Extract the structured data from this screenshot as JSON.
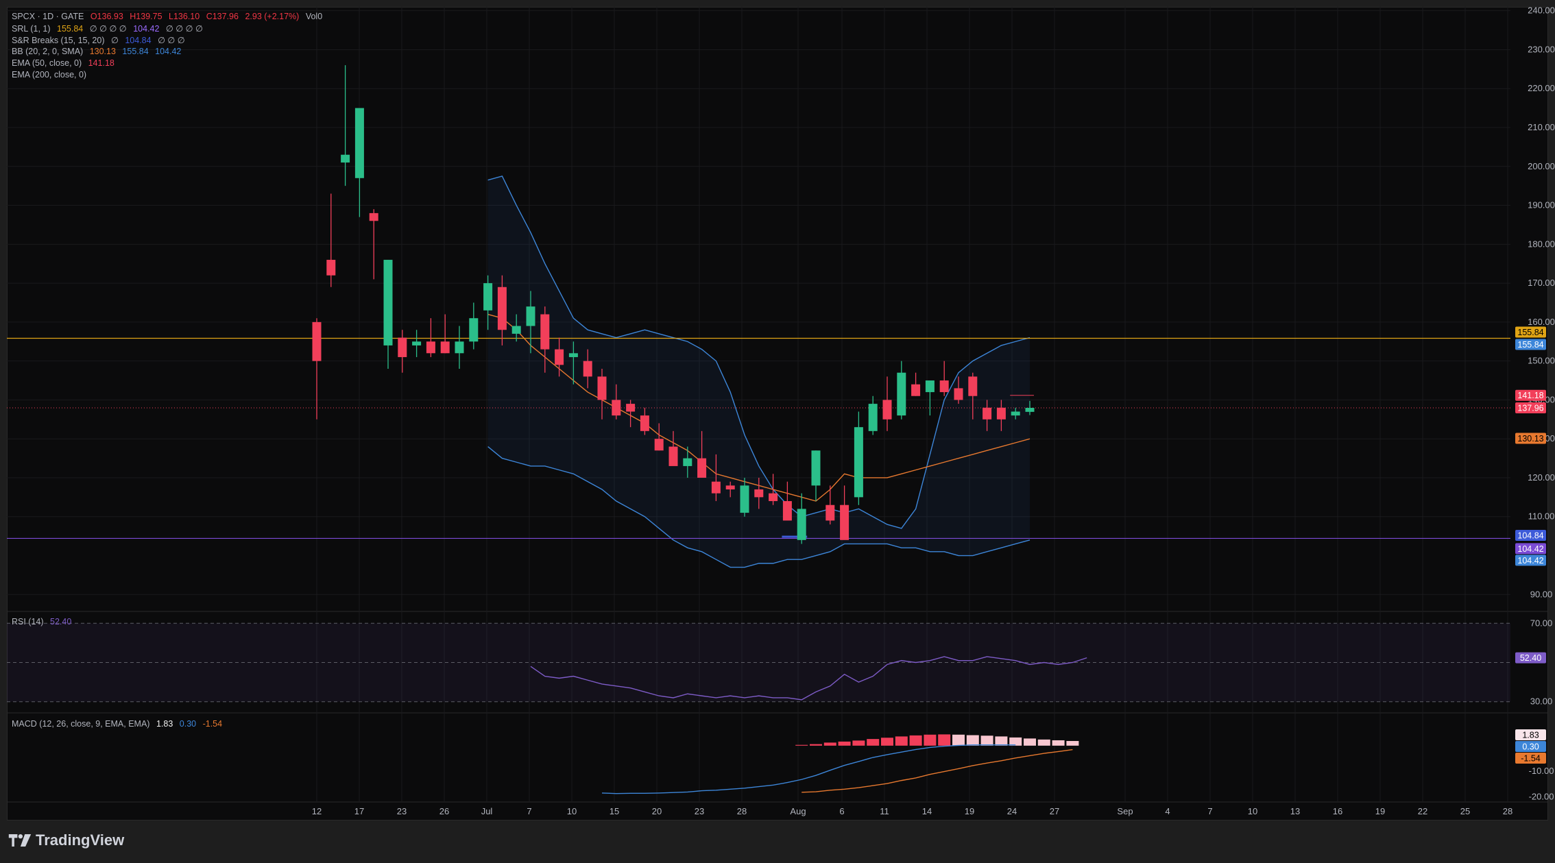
{
  "brand": "TradingView",
  "legend": {
    "symbol": "SPCX · 1D · GATE",
    "ohlc": {
      "o": "O136.93",
      "h": "H139.75",
      "l": "L136.10",
      "c": "C137.96",
      "chg": "2.93 (+2.17%)",
      "vol": "Vol0"
    },
    "srl": {
      "label": "SRL (1, 1)",
      "v1": "155.84",
      "nulls": "∅ ∅ ∅ ∅",
      "v2": "104.42",
      "nulls2": "∅ ∅ ∅ ∅"
    },
    "srb": {
      "label": "S&R Breaks (15, 15, 20)",
      "n1": "∅",
      "v1": "104.84",
      "nulls": "∅ ∅ ∅"
    },
    "bb": {
      "label": "BB (20, 2, 0, SMA)",
      "basis": "130.13",
      "upper": "155.84",
      "lower": "104.42"
    },
    "ema50": {
      "label": "EMA (50, close, 0)",
      "value": "141.18"
    },
    "ema200": {
      "label": "EMA (200, close, 0)"
    },
    "rsi": {
      "label": "RSI (14)",
      "value": "52.40"
    },
    "macd": {
      "label": "MACD (12, 26, close, 9, EMA, EMA)",
      "hist": "1.83",
      "macd": "0.30",
      "signal": "-1.54"
    }
  },
  "colors": {
    "up": "#2bbf8a",
    "down": "#f23f5a",
    "bb": "#3d86d9",
    "basis": "#e8792f",
    "srl_res": "#e0a415",
    "srl_sup": "#7b4bd6",
    "rsi": "#7e5cc8",
    "macd": "#3d86d9",
    "signal": "#e8792f"
  },
  "chart_data": [
    {
      "type": "candlestick",
      "title": "SPCX · 1D · GATE",
      "ylim": [
        86,
        241
      ],
      "yticks": [
        "90.00",
        "110.00",
        "120.00",
        "130.00",
        "140.00",
        "150.00",
        "160.00",
        "170.00",
        "180.00",
        "190.00",
        "200.00",
        "210.00",
        "220.00",
        "230.00",
        "240.00"
      ],
      "xticks": [
        "12",
        "17",
        "23",
        "26",
        "Jul",
        "7",
        "10",
        "15",
        "20",
        "23",
        "28",
        "Aug",
        "6",
        "11",
        "14",
        "19",
        "24",
        "27",
        "Sep",
        "4",
        "7",
        "10",
        "13",
        "16",
        "19",
        "22",
        "25",
        "28"
      ],
      "candles": [
        [
          160,
          161,
          135,
          150
        ],
        [
          176,
          193,
          169,
          172
        ],
        [
          201,
          226,
          195,
          203
        ],
        [
          197,
          214,
          187,
          215
        ],
        [
          188,
          189,
          171,
          186
        ],
        [
          154,
          176,
          148,
          176
        ],
        [
          156,
          158,
          147,
          151
        ],
        [
          154,
          158,
          151,
          155
        ],
        [
          155,
          161,
          151,
          152
        ],
        [
          155,
          162,
          152,
          152
        ],
        [
          152,
          159,
          148,
          155
        ],
        [
          155,
          165,
          153,
          161
        ],
        [
          163,
          172,
          158,
          170
        ],
        [
          169,
          172,
          154,
          158
        ],
        [
          157,
          162,
          155,
          159
        ],
        [
          159,
          168,
          152,
          164
        ],
        [
          162,
          164,
          147,
          153
        ],
        [
          153,
          156,
          146,
          149
        ],
        [
          151,
          155,
          144,
          152
        ],
        [
          150,
          153,
          143,
          146
        ],
        [
          146,
          148,
          135,
          140
        ],
        [
          140,
          144,
          135,
          136
        ],
        [
          139,
          140,
          133,
          137
        ],
        [
          136,
          138,
          131,
          132
        ],
        [
          130,
          134,
          127,
          127
        ],
        [
          128,
          132,
          124,
          123
        ],
        [
          123,
          128,
          120,
          125
        ],
        [
          125,
          132,
          121,
          120
        ],
        [
          119,
          126,
          114,
          116
        ],
        [
          118,
          119,
          115,
          117
        ],
        [
          111,
          120,
          110,
          118
        ],
        [
          117,
          120,
          112,
          115
        ],
        [
          116,
          121,
          113,
          114
        ],
        [
          114,
          119,
          111,
          109
        ],
        [
          104,
          116,
          103,
          112
        ],
        [
          118,
          127,
          114,
          127
        ],
        [
          113,
          118,
          108,
          109
        ],
        [
          113,
          118,
          106,
          104
        ],
        [
          115,
          137,
          113,
          133
        ],
        [
          132,
          141,
          131,
          139
        ],
        [
          140,
          146,
          132,
          135
        ],
        [
          136,
          150,
          135,
          147
        ],
        [
          144,
          147,
          141,
          141
        ],
        [
          142,
          143,
          136,
          145
        ],
        [
          145,
          150,
          141,
          142
        ],
        [
          143,
          146,
          139,
          140
        ],
        [
          146,
          147,
          135,
          141
        ],
        [
          138,
          140,
          132,
          135
        ],
        [
          138,
          140,
          132,
          135
        ],
        [
          136,
          138,
          135,
          137
        ],
        [
          136.93,
          139.75,
          136.1,
          137.96
        ]
      ],
      "srl_resistance": 155.84,
      "srl_support": 104.42,
      "srb_level": 104.84,
      "last_close": 137.96,
      "ema50_last": 141.18,
      "bb_upper": [
        196.5,
        197.5,
        190,
        183,
        175,
        168,
        161,
        158,
        157,
        156,
        157,
        158,
        157,
        156,
        155,
        153,
        150,
        142,
        131,
        123,
        117,
        113,
        110,
        111,
        112,
        111,
        112,
        110,
        108,
        107,
        112,
        126,
        140,
        147,
        150,
        152,
        154,
        155,
        156
      ],
      "bb_basis": [
        162,
        161,
        158,
        154,
        151,
        148,
        145,
        142,
        140,
        138,
        136,
        134,
        131,
        129,
        127,
        124,
        121,
        120,
        119,
        118,
        117,
        116,
        115,
        114,
        117,
        121,
        120,
        120,
        120,
        121,
        122,
        123,
        124,
        125,
        126,
        127,
        128,
        129,
        130
      ],
      "bb_lower": [
        128,
        125,
        124,
        123,
        123,
        122,
        121,
        119,
        117,
        114,
        112,
        110,
        107,
        104,
        102,
        101,
        99,
        97,
        97,
        98,
        98,
        99,
        99,
        100,
        101,
        103,
        103,
        103,
        103,
        102,
        102,
        101,
        101,
        100,
        100,
        101,
        102,
        103,
        104
      ],
      "bb_start_index": 12
    },
    {
      "type": "line",
      "title": "RSI (14)",
      "ylim": [
        25,
        75
      ],
      "yticks": [
        "30.00",
        "70.00"
      ],
      "bands": [
        30,
        50,
        70
      ],
      "start_index": 15,
      "values": [
        48,
        43,
        42,
        43,
        41,
        39,
        38,
        37,
        35,
        33,
        32,
        34,
        33,
        32,
        33,
        32,
        33,
        32,
        32,
        31,
        35,
        38,
        44,
        40,
        43,
        49,
        51,
        50,
        51,
        53,
        51,
        51,
        53,
        52,
        51,
        49,
        50,
        49,
        50,
        52.4
      ],
      "last": 52.4
    },
    {
      "type": "bar",
      "title": "MACD (12, 26, close, 9, EMA, EMA)",
      "ylim": [
        -22,
        12
      ],
      "yticks": [
        "-10.00",
        "-20.00"
      ],
      "hist_start_index": 34,
      "histogram": [
        0.3,
        0.6,
        1.2,
        1.6,
        2.0,
        2.6,
        3.1,
        3.6,
        4.0,
        4.3,
        4.4,
        4.3,
        4.1,
        3.9,
        3.6,
        3.2,
        2.8,
        2.4,
        2.1,
        1.83
      ],
      "macd_start_index": 20,
      "macd": [
        -18.5,
        -18.7,
        -18.6,
        -18.6,
        -18.5,
        -18.3,
        -18.1,
        -17.6,
        -17.4,
        -17.0,
        -16.6,
        -16.0,
        -15.4,
        -14.4,
        -13.2,
        -11.6,
        -9.6,
        -7.7,
        -6.2,
        -4.6,
        -3.5,
        -2.5,
        -1.5,
        -0.7,
        -0.2,
        0.1,
        0.3,
        0.3,
        0.3,
        0.3
      ],
      "signal_start_index": 34,
      "signal": [
        -18.2,
        -18.0,
        -17.4,
        -17.0,
        -16.4,
        -15.6,
        -14.8,
        -13.6,
        -12.6,
        -11.2,
        -10.1,
        -9.0,
        -7.8,
        -6.8,
        -5.9,
        -4.8,
        -3.9,
        -3.0,
        -2.3,
        -1.54
      ],
      "values_text": {
        "hist": "1.83",
        "macd": "0.30",
        "signal": "-1.54"
      }
    }
  ],
  "price_tags": [
    "155.84",
    "155.84",
    "141.18",
    "137.96",
    "130.13",
    "104.84",
    "104.42",
    "104.42"
  ],
  "rsi_tag": "52.40",
  "macd_tags": [
    "1.83",
    "0.30",
    "-1.54"
  ]
}
